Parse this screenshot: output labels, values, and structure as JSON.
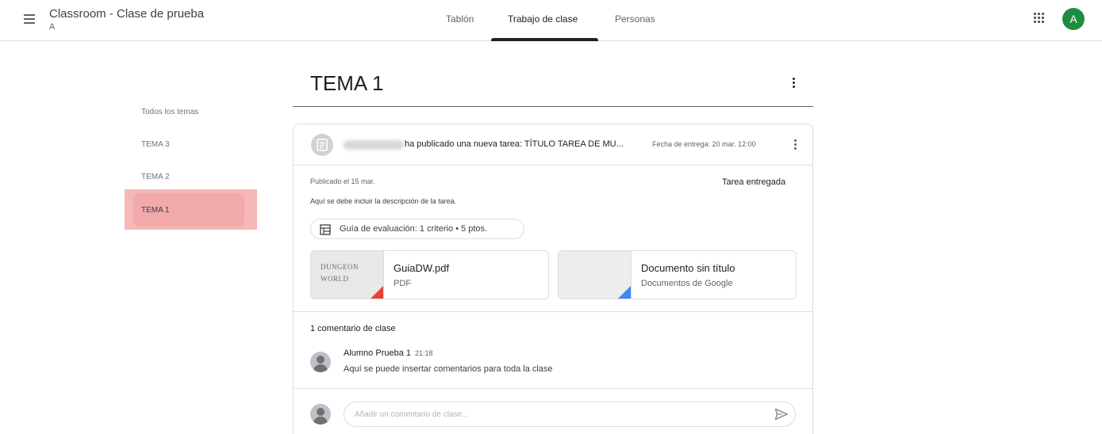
{
  "header": {
    "title": "Classroom - Clase de prueba",
    "subtitle": "A",
    "tabs": [
      {
        "label": "Tablón"
      },
      {
        "label": "Trabajo de clase",
        "active": true
      },
      {
        "label": "Personas"
      }
    ],
    "avatar_initial": "A",
    "avatar_color": "#1e8e3e"
  },
  "sidebar": {
    "items": [
      {
        "label": "Todos los temas"
      },
      {
        "label": "TEMA 3"
      },
      {
        "label": "TEMA 2"
      },
      {
        "label": "TEMA 1",
        "selected": true
      }
    ],
    "highlight_color": "#f5b7b8"
  },
  "topic": {
    "title": "TEMA 1"
  },
  "assignment": {
    "header_text": "ha publicado una nueva tarea: TÍTULO TAREA DE MU...",
    "due": "Fecha de entrega: 20 mar. 12:00",
    "posted": "Publicado el 15 mar.",
    "status": "Tarea entregada",
    "description": "Aquí se debe incluir la descripción de la tarea.",
    "rubric": "Guía de evaluación: 1 criterio • 5 ptos.",
    "attachments": [
      {
        "name": "GuiaDW.pdf",
        "type": "PDF",
        "thumb_text_1": "DUNGEON",
        "thumb_text_2": "WORLD",
        "corner_color": "#e94235"
      },
      {
        "name": "Documento sin título",
        "type": "Documentos de Google",
        "corner_color": "#4285f4"
      }
    ]
  },
  "comments": {
    "count_label": "1 comentario de clase",
    "items": [
      {
        "author": "Alumno Prueba 1",
        "time": "21:18",
        "text": "Aquí se puede insertar comentarios para toda la clase"
      }
    ],
    "input_placeholder": "Añadir un comentario de clase..."
  },
  "icons": {
    "menu": "menu-icon",
    "apps": "apps-grid-icon",
    "more": "more-vert-icon",
    "assignment": "assignment-icon",
    "rubric": "rubric-icon",
    "send": "send-icon"
  }
}
